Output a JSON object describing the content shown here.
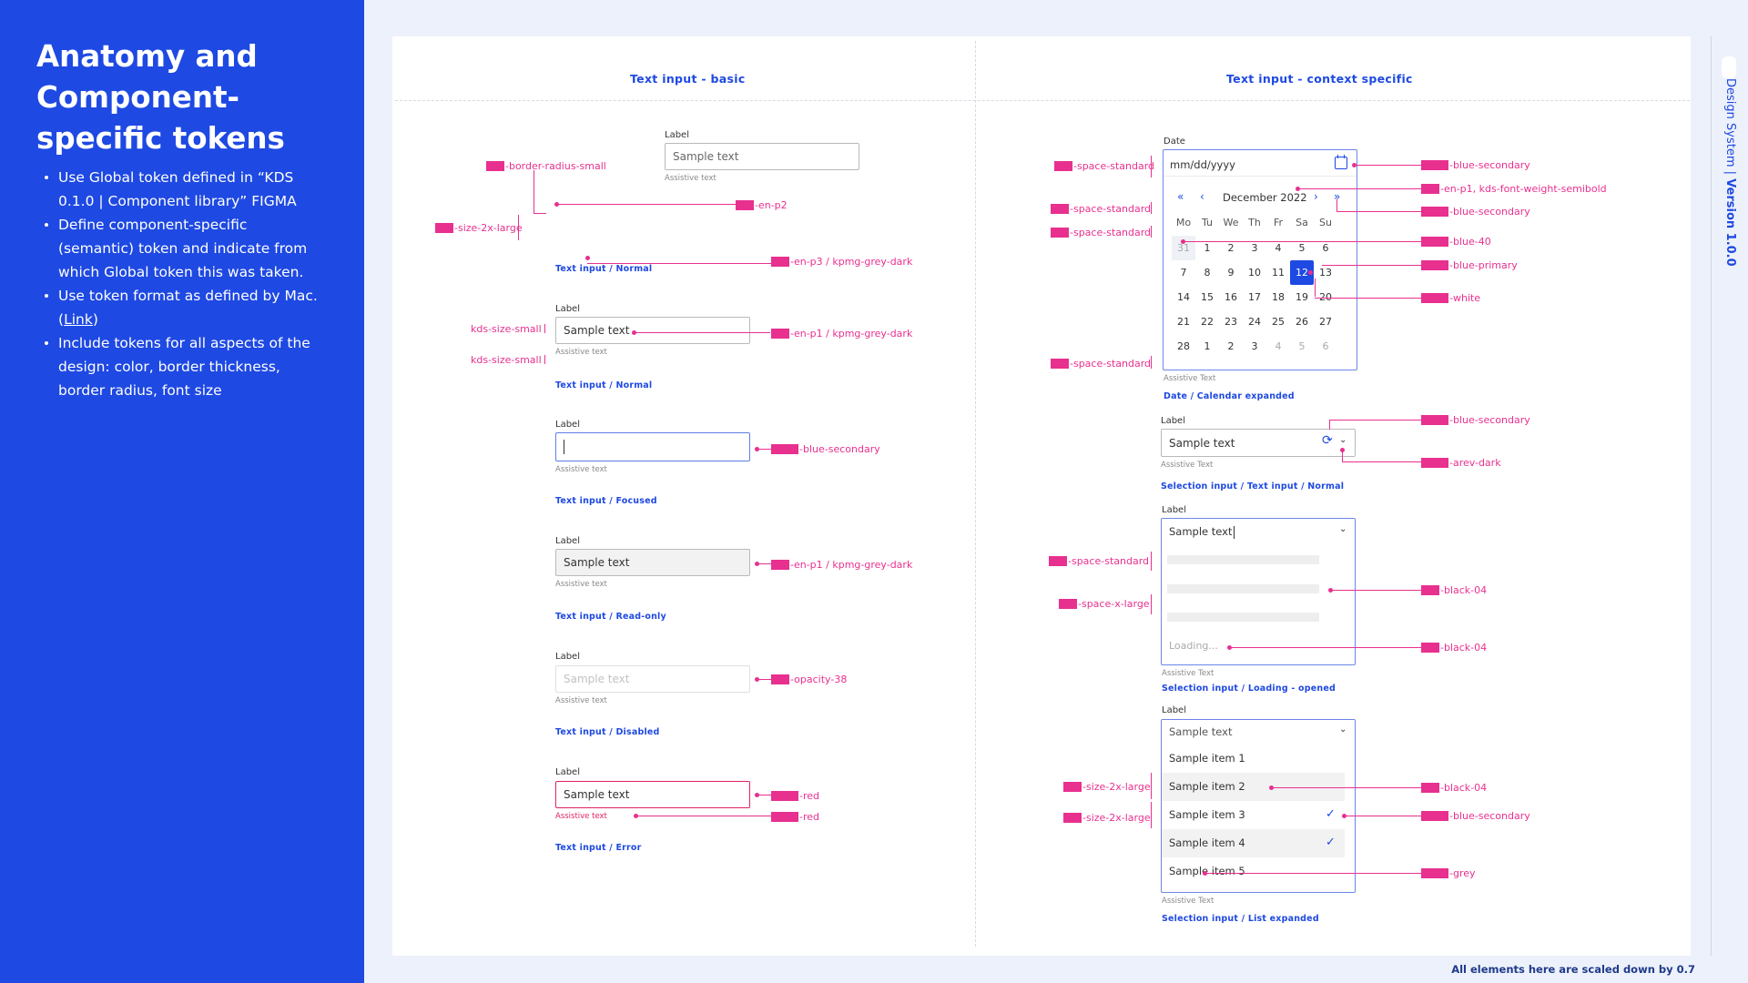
{
  "sidebar": {
    "title": "Anatomy and Component-specific tokens",
    "bullets": [
      "Use Global token defined in “KDS 0.1.0 | Component library” FIGMA",
      "Define component-specific (semantic) token and indicate from which Global token this was taken.",
      "Use token format as defined by Mac.",
      "Include tokens for all aspects of the design: color, border thickness, border radius, font size"
    ],
    "link_text": "Link"
  },
  "sections": {
    "left_title": "Text input - basic",
    "right_title": "Text input - context specific"
  },
  "rail": {
    "design_system": "Design System",
    "separator": "|",
    "version": "Version 1.0.0"
  },
  "footer_note": "All elements here are scaled down by 0.7",
  "basic": {
    "label": "Label",
    "assistive": "Assistive text",
    "sample": "Sample text",
    "captions": {
      "normal": "Text input / Normal",
      "focused": "Text input / Focused",
      "readonly": "Text input / Read-only",
      "disabled": "Text input / Disabled",
      "error": "Text input / Error"
    }
  },
  "tokens_left": {
    "border_radius": "-border-radius-small",
    "size_2x_large": "-size-2x-large",
    "en_p2": "-en-p2",
    "en_p3": "-en-p3 / kpmg-grey-dark",
    "kds_size_small": "kds-size-small",
    "en_p1": "-en-p1 / kpmg-grey-dark",
    "blue_secondary": "-blue-secondary",
    "opacity": "-opacity-38",
    "red": "-red"
  },
  "date": {
    "label": "Date",
    "placeholder": "mm/dd/yyyy",
    "month": "December 2022",
    "weekdays": [
      "Mo",
      "Tu",
      "We",
      "Th",
      "Fr",
      "Sa",
      "Su"
    ],
    "weeks": [
      [
        "31",
        "1",
        "2",
        "3",
        "4",
        "5",
        "6"
      ],
      [
        "7",
        "8",
        "9",
        "10",
        "11",
        "12",
        "13"
      ],
      [
        "14",
        "15",
        "16",
        "17",
        "18",
        "19",
        "20"
      ],
      [
        "21",
        "22",
        "23",
        "24",
        "25",
        "26",
        "27"
      ],
      [
        "28",
        "1",
        "2",
        "3",
        "4",
        "5",
        "6"
      ]
    ],
    "assistive": "Assistive Text",
    "caption": "Date / Calendar expanded"
  },
  "selection_normal": {
    "label": "Label",
    "value": "Sample text",
    "assistive": "Assistive Text",
    "caption": "Selection input / Text input / Normal"
  },
  "selection_loading": {
    "label": "Label",
    "value": "Sample text",
    "loading": "Loading...",
    "assistive": "Assistive Text",
    "caption": "Selection input / Loading - opened"
  },
  "selection_list": {
    "label": "Label",
    "placeholder": "Sample text",
    "items": [
      "Sample item 1",
      "Sample item 2",
      "Sample item 3",
      "Sample item 4",
      "Sample item 5"
    ],
    "assistive": "Assistive Text",
    "caption": "Selection input / List expanded"
  },
  "tokens_right": {
    "space_standard": "-space-standard",
    "space_x_large": "-space-x-large",
    "size_2x_large": "-size-2x-large",
    "blue_secondary": "-blue-secondary",
    "en_p1_semibold": "-en-p1, kds-font-weight-semibold",
    "blue_40": "-blue-40",
    "blue_primary": "-blue-primary",
    "white": "-white",
    "arev_dark": "-arev-dark",
    "black_04": "-black-04",
    "grey": "-grey"
  },
  "colors": {
    "brand_blue": "#1e49e2",
    "token_pink": "#e8308f",
    "error_red": "#e0245e"
  }
}
